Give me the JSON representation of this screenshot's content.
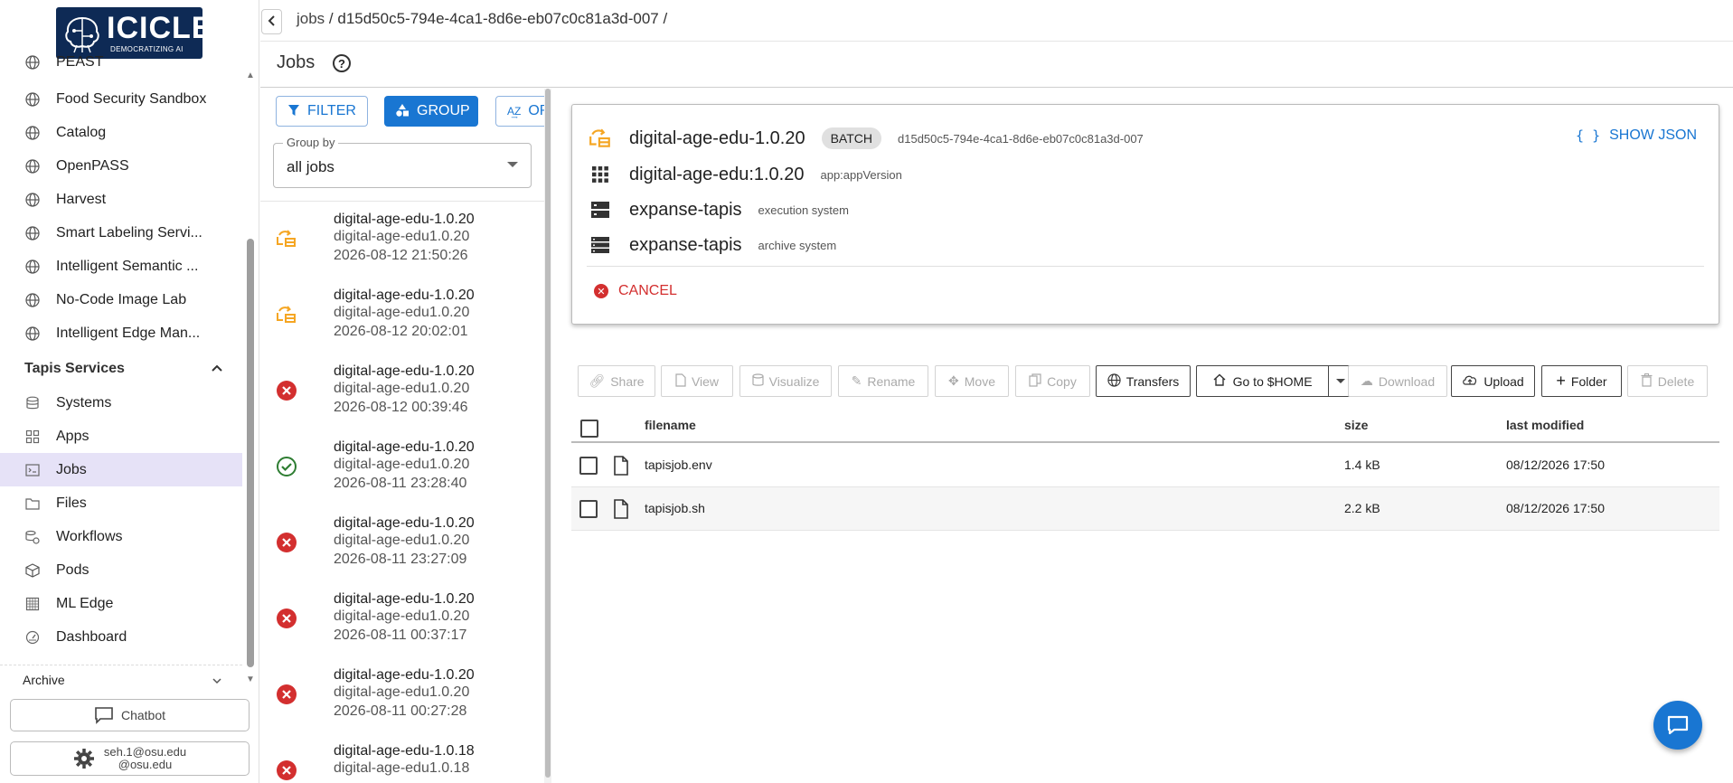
{
  "logo": {
    "title": "ICICLE",
    "subtitle": "DEMOCRATIZING AI"
  },
  "sidebar": {
    "items": [
      {
        "label": "PEAST",
        "icon": "globe-icon"
      },
      {
        "label": "Food Security Sandbox",
        "icon": "globe-icon"
      },
      {
        "label": "Catalog",
        "icon": "globe-icon"
      },
      {
        "label": "OpenPASS",
        "icon": "globe-icon"
      },
      {
        "label": "Harvest",
        "icon": "globe-icon"
      },
      {
        "label": "Smart Labeling Servi...",
        "icon": "globe-icon"
      },
      {
        "label": "Intelligent Semantic ...",
        "icon": "globe-icon"
      },
      {
        "label": "No-Code Image Lab",
        "icon": "globe-icon"
      },
      {
        "label": "Intelligent Edge Man...",
        "icon": "globe-icon"
      }
    ],
    "section_title": "Tapis Services",
    "services": [
      {
        "label": "Systems",
        "icon": "database-icon"
      },
      {
        "label": "Apps",
        "icon": "apps-grid-icon"
      },
      {
        "label": "Jobs",
        "icon": "terminal-icon",
        "active": true
      },
      {
        "label": "Files",
        "icon": "folder-icon"
      },
      {
        "label": "Workflows",
        "icon": "workflow-icon"
      },
      {
        "label": "Pods",
        "icon": "cube-icon"
      },
      {
        "label": "ML Edge",
        "icon": "chip-icon"
      },
      {
        "label": "Dashboard",
        "icon": "gauge-icon"
      }
    ],
    "archive_label": "Archive",
    "chatbot_label": "Chatbot",
    "user_line1": "seh.1@osu.edu",
    "user_line2": "@osu.edu"
  },
  "breadcrumb": {
    "root": "jobs",
    "sep": " / ",
    "job_id": "d15d50c5-794e-4ca1-8d6e-eb07c0c81a3d-007",
    "trail": " /"
  },
  "page_title": "Jobs",
  "help_glyph": "?",
  "job_panel": {
    "filter_label": "FILTER",
    "group_label": "GROUP",
    "order_label": "ORDER",
    "group_by_label": "Group by",
    "group_by_value": "all jobs",
    "jobs": [
      {
        "name": "digital-age-edu-1.0.20",
        "app": "digital-age-edu1.0.20",
        "time": "2026-08-12 21:50:26",
        "status": "running"
      },
      {
        "name": "digital-age-edu-1.0.20",
        "app": "digital-age-edu1.0.20",
        "time": "2026-08-12 20:02:01",
        "status": "running"
      },
      {
        "name": "digital-age-edu-1.0.20",
        "app": "digital-age-edu1.0.20",
        "time": "2026-08-12 00:39:46",
        "status": "failed"
      },
      {
        "name": "digital-age-edu-1.0.20",
        "app": "digital-age-edu1.0.20",
        "time": "2026-08-11 23:28:40",
        "status": "finished"
      },
      {
        "name": "digital-age-edu-1.0.20",
        "app": "digital-age-edu1.0.20",
        "time": "2026-08-11 23:27:09",
        "status": "failed"
      },
      {
        "name": "digital-age-edu-1.0.20",
        "app": "digital-age-edu1.0.20",
        "time": "2026-08-11 00:37:17",
        "status": "failed"
      },
      {
        "name": "digital-age-edu-1.0.20",
        "app": "digital-age-edu1.0.20",
        "time": "2026-08-11 00:27:28",
        "status": "failed"
      },
      {
        "name": "digital-age-edu-1.0.18",
        "app": "digital-age-edu1.0.18",
        "time": "",
        "status": "failed"
      }
    ]
  },
  "detail": {
    "job_name": "digital-age-edu-1.0.20",
    "job_type": "BATCH",
    "job_uuid": "d15d50c5-794e-4ca1-8d6e-eb07c0c81a3d-007",
    "show_json_label": "SHOW JSON",
    "app_id": "digital-age-edu:1.0.20",
    "app_caption": "app:appVersion",
    "exec_system": "expanse-tapis",
    "exec_caption": "execution system",
    "archive_system": "expanse-tapis",
    "archive_caption": "archive system",
    "cancel_label": "CANCEL"
  },
  "file_toolbar": {
    "share": "Share",
    "view": "View",
    "visualize": "Visualize",
    "rename": "Rename",
    "move": "Move",
    "copy": "Copy",
    "transfers": "Transfers",
    "home": "Go to $HOME",
    "download": "Download",
    "upload": "Upload",
    "folder": "Folder",
    "delete": "Delete"
  },
  "files": {
    "headers": {
      "name": "filename",
      "size": "size",
      "modified": "last modified"
    },
    "rows": [
      {
        "name": "tapisjob.env",
        "size": "1.4 kB",
        "modified": "08/12/2026 17:50"
      },
      {
        "name": "tapisjob.sh",
        "size": "2.2 kB",
        "modified": "08/12/2026 17:50"
      }
    ]
  },
  "colors": {
    "primary": "#1976d2",
    "running": "#f5a623",
    "failed": "#d32f2f",
    "finished": "#2e7d32",
    "active_nav": "#e6e2f7",
    "logo_bg": "#0e2a55"
  }
}
